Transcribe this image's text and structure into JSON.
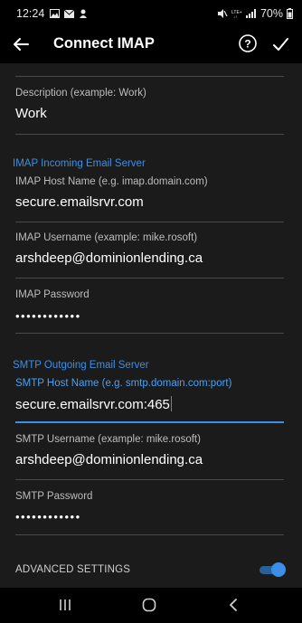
{
  "status_bar": {
    "time": "12:24",
    "battery": "70%",
    "icons": [
      "image-icon",
      "mail-icon",
      "notification-icon",
      "mute-icon",
      "lte-icon",
      "signal-icon",
      "battery-icon"
    ]
  },
  "app_bar": {
    "title": "Connect IMAP",
    "icons": [
      "back-arrow-icon",
      "help-icon",
      "checkmark-icon"
    ]
  },
  "fields": {
    "description": {
      "label": "Description (example: Work)",
      "value": "Work"
    },
    "imap_host": {
      "label": "IMAP Host Name (e.g. imap.domain.com)",
      "value": "secure.emailsrvr.com"
    },
    "imap_username": {
      "label": "IMAP Username (example: mike.rosoft)",
      "value": "arshdeep@dominionlending.ca"
    },
    "imap_password": {
      "label": "IMAP Password",
      "value": "••••••••••••"
    },
    "smtp_host": {
      "label": "SMTP Host Name (e.g. smtp.domain.com:port)",
      "value": "secure.emailsrvr.com:465"
    },
    "smtp_username": {
      "label": "SMTP Username (example: mike.rosoft)",
      "value": "arshdeep@dominionlending.ca"
    },
    "smtp_password": {
      "label": "SMTP Password",
      "value": "••••••••••••"
    }
  },
  "sections": {
    "imap": "IMAP Incoming Email Server",
    "smtp": "SMTP Outgoing Email Server"
  },
  "advanced": {
    "label": "ADVANCED SETTINGS",
    "enabled": true
  },
  "colors": {
    "accent": "#3b8fe8",
    "background": "#1b1b1b",
    "bar": "#000000"
  },
  "navigation_bar": {
    "icons": [
      "recent-apps-icon",
      "home-icon",
      "back-icon"
    ]
  }
}
